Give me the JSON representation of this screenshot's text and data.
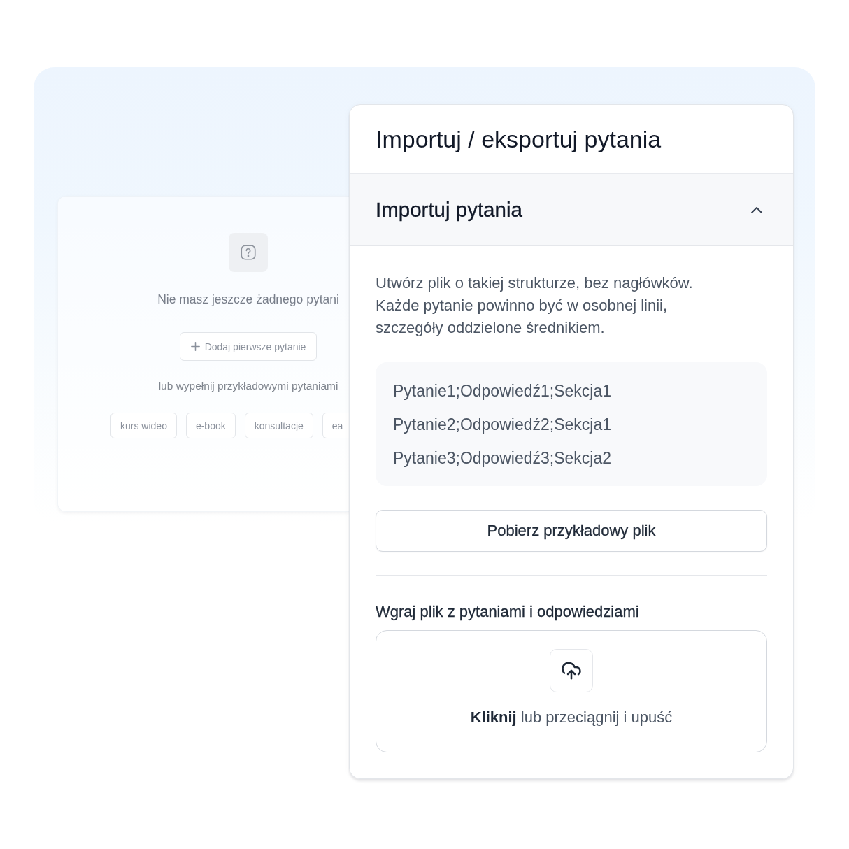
{
  "empty_state_card": {
    "title": "Nie masz jeszcze żadnego pytani",
    "add_button": {
      "label": "Dodaj pierwsze pytanie"
    },
    "fill_hint": "lub wypełnij przykładowymi pytaniami",
    "templates": [
      "kurs wideo",
      "e-book",
      "konsultacje",
      "ea"
    ]
  },
  "dialog": {
    "title": "Importuj / eksportuj pytania",
    "import_section": {
      "title": "Importuj pytania",
      "expanded": true,
      "instructions": "Utwórz plik o takiej strukturze, bez nagłówków. Każde pytanie powinno być w osobnej linii, szczegóły oddzielone średnikiem.",
      "example_lines": [
        "Pytanie1;Odpowiedź1;Sekcja1",
        "Pytanie2;Odpowiedź2;Sekcja1",
        "Pytanie3;Odpowiedź3;Sekcja2"
      ],
      "download_button": {
        "label": "Pobierz przykładowy plik"
      },
      "upload": {
        "label": "Wgraj plik z pytaniami i odpowiedziami",
        "dropzone_text": "**Kliknij** lub przeciągnij i upuść"
      }
    }
  }
}
